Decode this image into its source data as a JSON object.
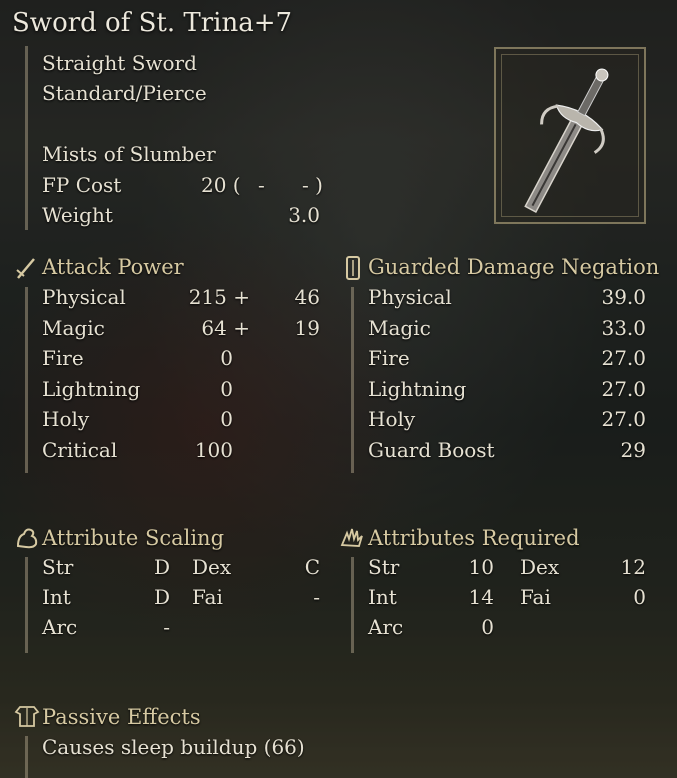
{
  "item": {
    "name": "Sword of St. Trina+7",
    "weapon_type": "Straight Sword",
    "damage_type": "Standard/Pierce",
    "skill": "Mists of Slumber",
    "fp_cost_label": "FP Cost",
    "fp_cost_value": "20 (",
    "fp_cost_dash1": "-",
    "fp_cost_dash2": "- )",
    "weight_label": "Weight",
    "weight_value": "3.0"
  },
  "attack_power": {
    "header": "Attack Power",
    "rows": [
      {
        "label": "Physical",
        "base": "215 +",
        "bonus": "46"
      },
      {
        "label": "Magic",
        "base": "64 +",
        "bonus": "19"
      },
      {
        "label": "Fire",
        "base": "0",
        "bonus": ""
      },
      {
        "label": "Lightning",
        "base": "0",
        "bonus": ""
      },
      {
        "label": "Holy",
        "base": "0",
        "bonus": ""
      },
      {
        "label": "Critical",
        "base": "100",
        "bonus": ""
      }
    ]
  },
  "guarded": {
    "header": "Guarded Damage Negation",
    "rows": [
      {
        "label": "Physical",
        "value": "39.0"
      },
      {
        "label": "Magic",
        "value": "33.0"
      },
      {
        "label": "Fire",
        "value": "27.0"
      },
      {
        "label": "Lightning",
        "value": "27.0"
      },
      {
        "label": "Holy",
        "value": "27.0"
      },
      {
        "label": "Guard Boost",
        "value": "29"
      }
    ]
  },
  "scaling": {
    "header": "Attribute Scaling",
    "str_label": "Str",
    "str_value": "D",
    "dex_label": "Dex",
    "dex_value": "C",
    "int_label": "Int",
    "int_value": "D",
    "fai_label": "Fai",
    "fai_value": "-",
    "arc_label": "Arc",
    "arc_value": "-"
  },
  "required": {
    "header": "Attributes Required",
    "str_label": "Str",
    "str_value": "10",
    "dex_label": "Dex",
    "dex_value": "12",
    "int_label": "Int",
    "int_value": "14",
    "fai_label": "Fai",
    "fai_value": "0",
    "arc_label": "Arc",
    "arc_value": "0"
  },
  "passive": {
    "header": "Passive Effects",
    "effect": "Causes sleep buildup (66)"
  },
  "icons": {
    "attack": "sword-icon",
    "guard": "shield-icon",
    "scaling": "arm-icon",
    "required": "hand-icon",
    "passive": "armor-icon",
    "item_image": "straight-sword-icon"
  }
}
